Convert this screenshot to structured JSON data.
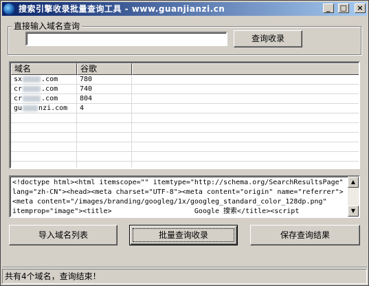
{
  "window": {
    "title": "搜索引擎收录批量查询工具 - www.guanjianzi.cn",
    "minimize_glyph": "_",
    "maximize_glyph": "□",
    "close_glyph": "×"
  },
  "domain_input": {
    "group_label": "直接输入域名查询",
    "value": "",
    "query_button": "查询收录"
  },
  "result_list": {
    "columns": [
      "域名",
      "谷歌"
    ],
    "rows": [
      {
        "domain_prefix": "sx",
        "domain_suffix": ".com",
        "google": "780"
      },
      {
        "domain_prefix": "cr",
        "domain_suffix": ".com",
        "google": "740"
      },
      {
        "domain_prefix": "cr",
        "domain_suffix": ".com",
        "google": "804"
      },
      {
        "domain_prefix": "gu",
        "domain_suffix": "nzi.com",
        "google": "4"
      }
    ]
  },
  "html_output": {
    "lines": [
      "<!doctype html><html itemscope=\"\" itemtype=\"http://schema.org/SearchResultsPage\"",
      "lang=\"zh-CN\"><head><meta charset=\"UTF-8\"><meta content=\"origin\" name=\"referrer\">",
      "<meta content=\"/images/branding/googleg/1x/googleg_standard_color_128dp.png\"",
      "itemprop=\"image\"><title>                    Google 搜索</title><script"
    ]
  },
  "buttons": {
    "import_list": "导入域名列表",
    "batch_query": "批量查询收录",
    "save_results": "保存查询结果"
  },
  "status": {
    "text": "共有4个域名，查询结束！"
  },
  "icons": {
    "app": "globe-icon",
    "scroll_up": "arrow-up-icon",
    "scroll_down": "arrow-down-icon"
  }
}
